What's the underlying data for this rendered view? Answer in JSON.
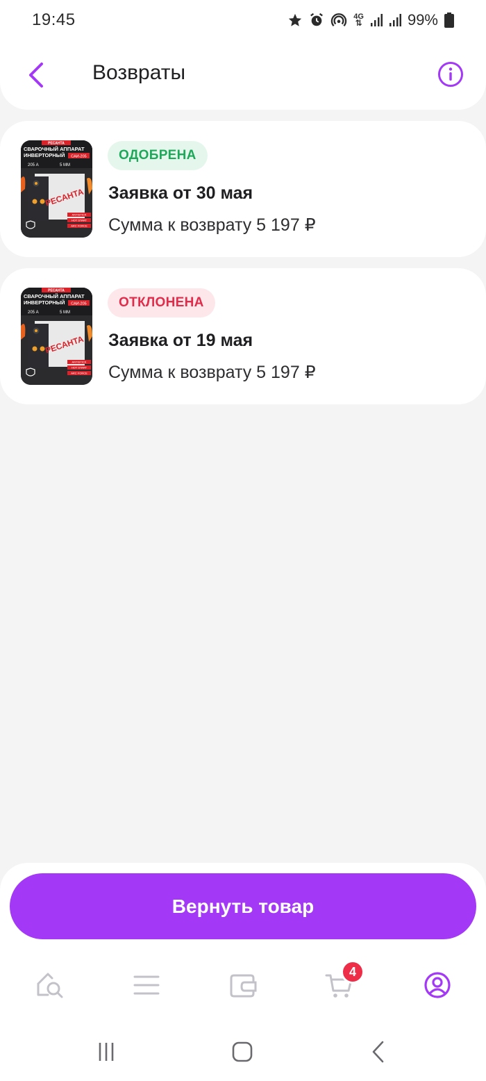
{
  "status_bar": {
    "time": "19:45",
    "network": "4G",
    "battery": "99%"
  },
  "header": {
    "title": "Возвраты"
  },
  "returns": [
    {
      "status": "ОДОБРЕНА",
      "status_type": "approved",
      "title": "Заявка от 30 мая",
      "amount": "Сумма к возврату 5 197 ₽",
      "product_image": {
        "brand": "РЕСАНТА",
        "headline": "СВАРОЧНЫЙ АППАРАТ ИНВЕРТОРНЫЙ",
        "model": "САИ-205",
        "spec_current": "205 А",
        "spec_electrode": "5 ММ",
        "features": [
          "ANTISTICK",
          "HOT START",
          "ARC FORCE"
        ]
      }
    },
    {
      "status": "ОТКЛОНЕНА",
      "status_type": "rejected",
      "title": "Заявка от 19 мая",
      "amount": "Сумма к возврату 5 197 ₽",
      "product_image": {
        "brand": "РЕСАНТА",
        "headline": "СВАРОЧНЫЙ АППАРАТ ИНВЕРТОРНЫЙ",
        "model": "САИ-205",
        "spec_current": "205 А",
        "spec_electrode": "5 ММ",
        "features": [
          "ANTISTICK",
          "HOT START",
          "ARC FORCE"
        ]
      }
    }
  ],
  "actions": {
    "return_button": "Вернуть товар"
  },
  "tabbar": {
    "items": [
      {
        "icon": "home-search-icon",
        "active": false
      },
      {
        "icon": "menu-icon",
        "active": false
      },
      {
        "icon": "wallet-icon",
        "active": false
      },
      {
        "icon": "cart-icon",
        "active": false
      },
      {
        "icon": "profile-icon",
        "active": true
      }
    ],
    "cart_count": "4"
  },
  "colors": {
    "accent": "#a338f6",
    "approved": "#1ea85a",
    "rejected": "#e02c4b",
    "background": "#f4f4f5",
    "inactive_icon": "#c2c2c8"
  }
}
